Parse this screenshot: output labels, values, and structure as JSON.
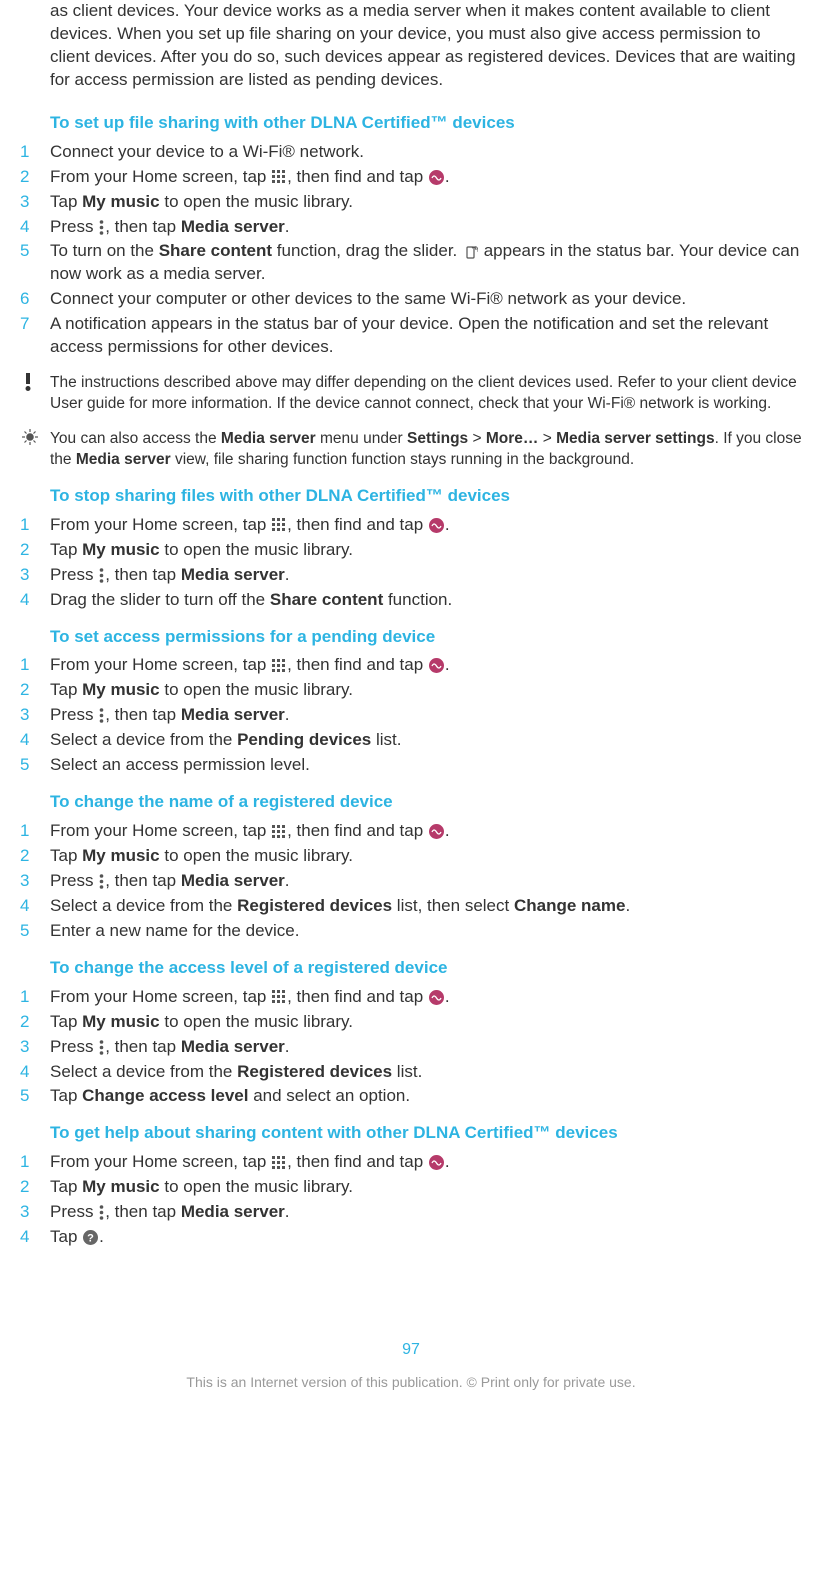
{
  "intro": "as client devices. Your device works as a media server when it makes content available to client devices. When you set up file sharing on your device, you must also give access permission to client devices. After you do so, such devices appear as registered devices. Devices that are waiting for access permission are listed as pending devices.",
  "sections": [
    {
      "heading": "To set up file sharing with other DLNA Certified™ devices",
      "steps": [
        {
          "n": "1",
          "html": "Connect your device to a Wi-Fi® network."
        },
        {
          "n": "2",
          "html": "From your Home screen, tap {apps}, then find and tap {walkman}."
        },
        {
          "n": "3",
          "html": "Tap <b>My music</b> to open the music library."
        },
        {
          "n": "4",
          "html": "Press {menu}, then tap <b>Media server</b>."
        },
        {
          "n": "5",
          "html": "To turn on the <b>Share content</b> function, drag the slider. {share} appears in the status bar. Your device can now work as a media server."
        },
        {
          "n": "6",
          "html": "Connect your computer or other devices to the same Wi-Fi® network as your device."
        },
        {
          "n": "7",
          "html": "A notification appears in the status bar of your device. Open the notification and set the relevant access permissions for other devices."
        }
      ],
      "notes": [
        {
          "icon": "warn",
          "html": "The instructions described above may differ depending on the client devices used. Refer to your client device User guide for more information. If the device cannot connect, check that your Wi-Fi® network is working."
        },
        {
          "icon": "tip",
          "html": "You can also access the <b>Media server</b> menu under <b>Settings</b> > <b>More…</b> > <b>Media server settings</b>. If you close the <b>Media server</b> view, file sharing function function stays running in the background."
        }
      ]
    },
    {
      "heading": "To stop sharing files with other DLNA Certified™ devices",
      "steps": [
        {
          "n": "1",
          "html": "From your Home screen, tap {apps}, then find and tap {walkman}."
        },
        {
          "n": "2",
          "html": "Tap <b>My music</b> to open the music library."
        },
        {
          "n": "3",
          "html": "Press {menu}, then tap <b>Media server</b>."
        },
        {
          "n": "4",
          "html": "Drag the slider to turn off the <b>Share content</b> function."
        }
      ],
      "notes": []
    },
    {
      "heading": "To set access permissions for a pending device",
      "steps": [
        {
          "n": "1",
          "html": "From your Home screen, tap {apps}, then find and tap {walkman}."
        },
        {
          "n": "2",
          "html": "Tap <b>My music</b> to open the music library."
        },
        {
          "n": "3",
          "html": "Press {menu}, then tap <b>Media server</b>."
        },
        {
          "n": "4",
          "html": "Select a device from the <b>Pending devices</b> list."
        },
        {
          "n": "5",
          "html": "Select an access permission level."
        }
      ],
      "notes": []
    },
    {
      "heading": "To change the name of a registered device",
      "steps": [
        {
          "n": "1",
          "html": "From your Home screen, tap {apps}, then find and tap {walkman}."
        },
        {
          "n": "2",
          "html": "Tap <b>My music</b> to open the music library."
        },
        {
          "n": "3",
          "html": "Press {menu}, then tap <b>Media server</b>."
        },
        {
          "n": "4",
          "html": "Select a device from the <b>Registered devices</b> list, then select <b>Change name</b>."
        },
        {
          "n": "5",
          "html": "Enter a new name for the device."
        }
      ],
      "notes": []
    },
    {
      "heading": "To change the access level of a registered device",
      "steps": [
        {
          "n": "1",
          "html": "From your Home screen, tap {apps}, then find and tap {walkman}."
        },
        {
          "n": "2",
          "html": "Tap <b>My music</b> to open the music library."
        },
        {
          "n": "3",
          "html": "Press {menu}, then tap <b>Media server</b>."
        },
        {
          "n": "4",
          "html": "Select a device from the <b>Registered devices</b> list."
        },
        {
          "n": "5",
          "html": "Tap <b>Change access level</b> and select an option."
        }
      ],
      "notes": []
    },
    {
      "heading": "To get help about sharing content with other DLNA Certified™ devices",
      "steps": [
        {
          "n": "1",
          "html": "From your Home screen, tap {apps}, then find and tap {walkman}."
        },
        {
          "n": "2",
          "html": "Tap <b>My music</b> to open the music library."
        },
        {
          "n": "3",
          "html": "Press {menu}, then tap <b>Media server</b>."
        },
        {
          "n": "4",
          "html": "Tap {help}."
        }
      ],
      "notes": []
    }
  ],
  "pageNumber": "97",
  "footer": "This is an Internet version of this publication. © Print only for private use."
}
